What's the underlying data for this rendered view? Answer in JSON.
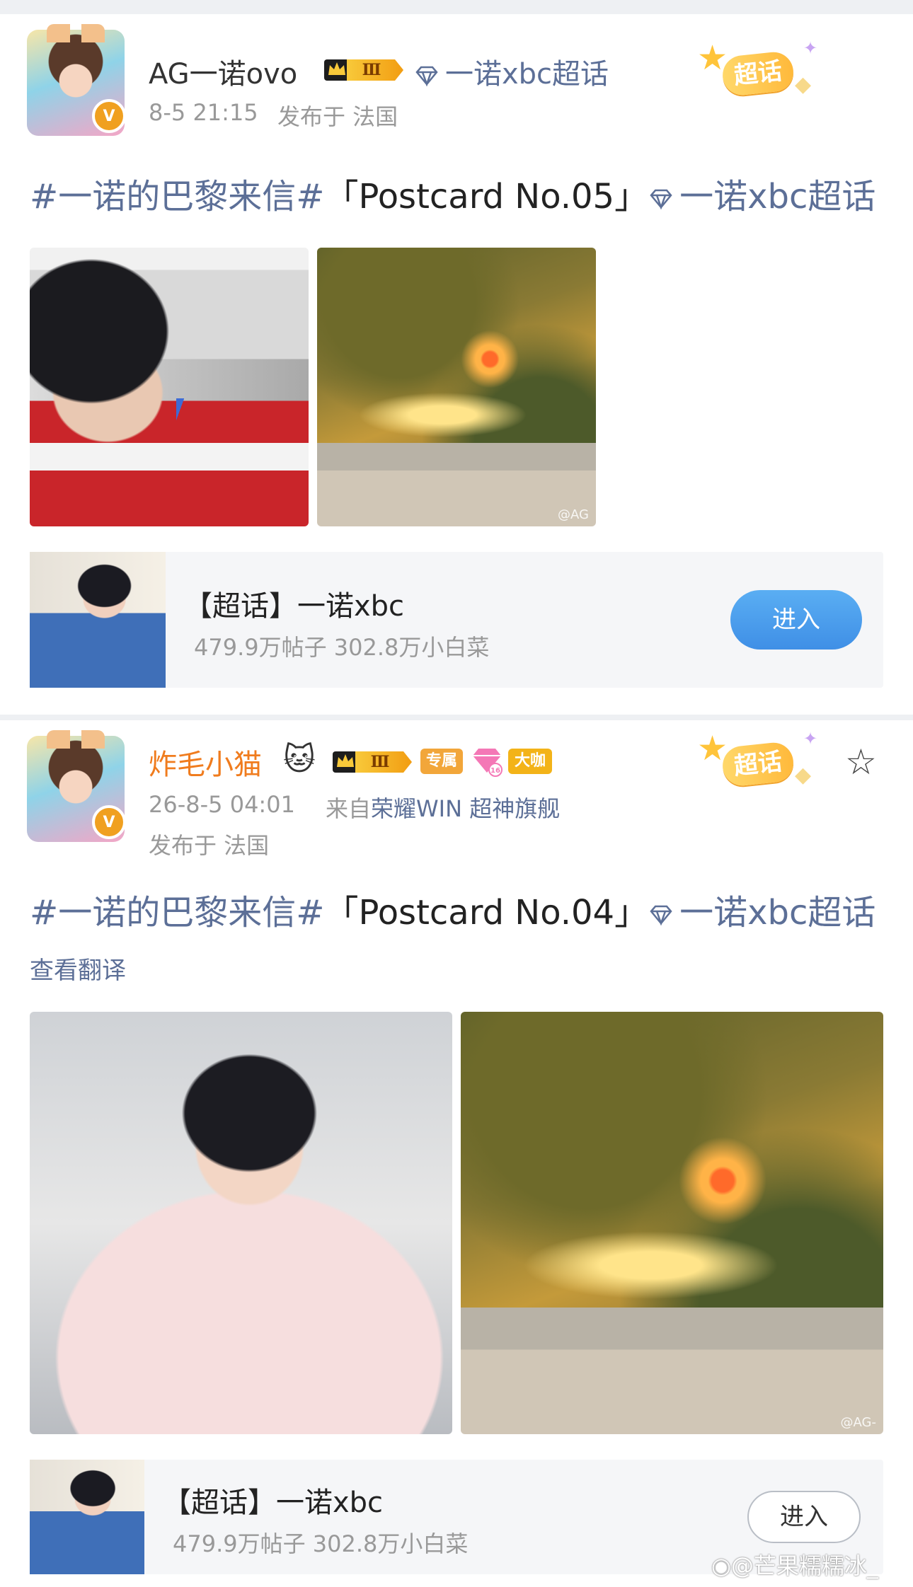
{
  "post1": {
    "author": "AG一诺ovo",
    "level": "Ⅲ",
    "supertopic_link": "一诺xbc超话",
    "time": "8-5 21:15",
    "location": "发布于 法国",
    "badge": "超话",
    "headline_tag": "#一诺的巴黎来信#",
    "headline_text": "「Postcard No.05」",
    "headline_topic": "一诺xbc超话",
    "watermark": "@AG",
    "card": {
      "title": "【超话】一诺xbc",
      "stats": "479.9万帖子 302.8万小白菜",
      "button": "进入"
    }
  },
  "post2": {
    "author": "炸毛小猫",
    "level": "Ⅲ",
    "tag_exclusive": "专属",
    "tag_num": "16",
    "tag_bigshot": "大咖",
    "badge": "超话",
    "time": "26-8-5 04:01",
    "source_prefix": "来自",
    "source_device": "荣耀WIN 超神旗舰",
    "location": "发布于 法国",
    "headline_tag": "#一诺的巴黎来信#",
    "headline_text": "「Postcard No.04」",
    "headline_topic": "一诺xbc超话",
    "translate": "查看翻译",
    "watermark": "@AG-",
    "card": {
      "title": "【超话】一诺xbc",
      "stats": "479.9万帖子 302.8万小白菜",
      "button": "进入"
    }
  },
  "footer_watermark": "@芒果糯糯冰_",
  "colors": {
    "link": "#5c6f97",
    "author_orange": "#f07c1e",
    "button_blue": "#3f8fe6",
    "gold": "#f8c93a"
  }
}
